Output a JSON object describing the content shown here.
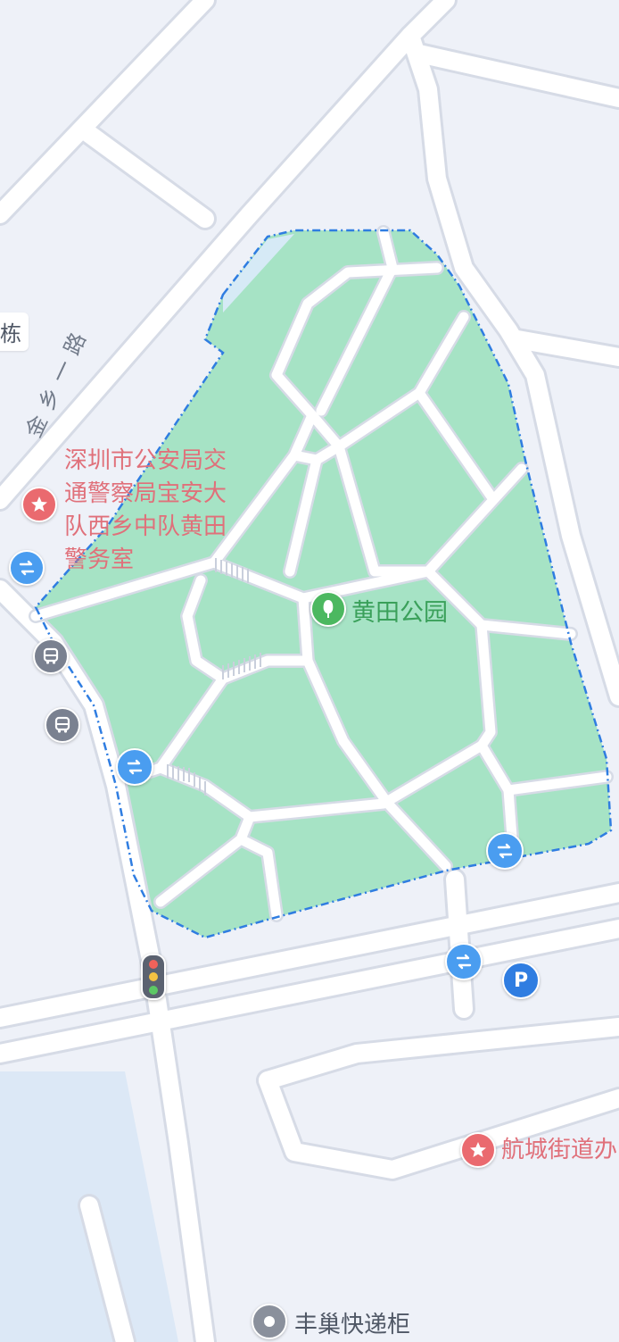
{
  "map": {
    "pois": [
      {
        "id": "police",
        "lines": [
          "深圳市公安局交",
          "通警察局宝安大",
          "队西乡中队黄田",
          "警务室"
        ]
      },
      {
        "id": "park",
        "label": "黄田公园"
      },
      {
        "id": "street-office",
        "label": "航城街道办"
      },
      {
        "id": "locker",
        "label": "丰巢快递柜"
      },
      {
        "id": "building",
        "label": "栋"
      }
    ],
    "road_name": "金乡一路",
    "icons": {
      "transfer": "transfer-icon",
      "bus": "bus-icon",
      "parking": "parking-icon",
      "police_star": "star-icon",
      "park_tree": "tree-icon",
      "traffic_light": "traffic-light-icon",
      "locker": "locker-icon"
    },
    "colors": {
      "background": "#eef1f8",
      "road": "#ffffff",
      "road_edge": "#d6dbe6",
      "park": "#a6e3c5",
      "boundary": "#2f7de1",
      "poi_text": "#e0707a",
      "park_text": "#3aa05a"
    }
  }
}
